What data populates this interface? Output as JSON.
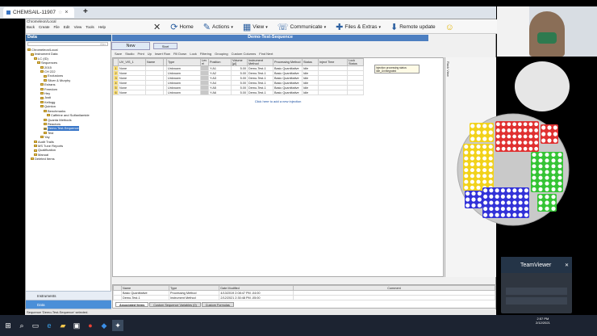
{
  "browser": {
    "tab_title": "CHEMSAIL-11907",
    "close_glyph": "×",
    "new_tab_glyph": "+"
  },
  "app": {
    "breadcrumb": "Chromeleon/Local",
    "toolbar": {
      "back": "Back",
      "create": "Create",
      "file": "File",
      "edit": "Edit",
      "view": "View",
      "tools": "Tools",
      "help": "Help"
    },
    "big_toolbar": {
      "home": "Home",
      "actions": "Actions",
      "view": "View",
      "communicate": "Communicate",
      "files_extras": "Files & Extras",
      "remote_update": "Remote update"
    },
    "left_panel": {
      "title": "Data",
      "filter_placeholder": "filter",
      "tree": [
        {
          "label": "Chromeleon/Local",
          "indent": 0
        },
        {
          "label": "Instrument Data",
          "indent": 1
        },
        {
          "label": "LC (ID)",
          "indent": 2
        },
        {
          "label": "Sequences",
          "indent": 3
        },
        {
          "label": "2015",
          "indent": 4
        },
        {
          "label": "CH 222",
          "indent": 4
        },
        {
          "label": "Exclusions",
          "indent": 5
        },
        {
          "label": "Silver & Murphy",
          "indent": 5
        },
        {
          "label": "Estrans",
          "indent": 4
        },
        {
          "label": "Freedom",
          "indent": 4
        },
        {
          "label": "Hey",
          "indent": 4
        },
        {
          "label": "Justi",
          "indent": 4
        },
        {
          "label": "Kellogg",
          "indent": 4
        },
        {
          "label": "Quinton",
          "indent": 4
        },
        {
          "label": "Benchmarks",
          "indent": 5
        },
        {
          "label": "Caffeine and Sulfanilamide",
          "indent": 6
        },
        {
          "label": "Quanta Methods",
          "indent": 5
        },
        {
          "label": "Reactors",
          "indent": 5
        },
        {
          "label": "Demo-Test-Sequence",
          "indent": 5,
          "selected": true
        },
        {
          "label": "Test",
          "indent": 5
        },
        {
          "label": "Yay",
          "indent": 4
        },
        {
          "label": "Audit Trails",
          "indent": 2
        },
        {
          "label": "MS Tune Reports",
          "indent": 2
        },
        {
          "label": "Qualification",
          "indent": 2
        },
        {
          "label": "Manual",
          "indent": 2
        },
        {
          "label": "Deleted Items",
          "indent": 1
        }
      ],
      "nav": [
        "Instruments",
        "Data",
        "eWorkflows"
      ]
    },
    "main": {
      "title": "Demo-Test-Sequence",
      "new_label": "New",
      "start_label": "Start",
      "toolbar": [
        "Save",
        "Studio",
        "Print",
        "Up",
        "Insert Row",
        "Fill Down",
        "Lock",
        "Filtering",
        "Grouping",
        "Custom Columns",
        "Find Next"
      ],
      "columns": [
        "",
        "UV_VIS_1",
        "Name",
        "",
        "Type",
        "Lev el",
        "Position",
        "Volume [µl]",
        "Instrument Method",
        "Processing Method",
        "Status",
        "Inject Time",
        "Lock Status"
      ],
      "rows": [
        {
          "num": "1",
          "uv": "None",
          "name": "",
          "type": "Unknown",
          "pos": "Y:A1",
          "vol": "5.00",
          "inst": "Demo-Test-1",
          "proc": "Basic Quantitative",
          "status": "Idle"
        },
        {
          "num": "2",
          "uv": "None",
          "name": "",
          "type": "Unknown",
          "pos": "Y:A2",
          "vol": "5.00",
          "inst": "Demo-Test-1",
          "proc": "Basic Quantitative",
          "status": "Idle"
        },
        {
          "num": "3",
          "uv": "None",
          "name": "",
          "type": "Unknown",
          "pos": "Y:A3",
          "vol": "5.00",
          "inst": "Demo-Test-1",
          "proc": "Basic Quantitative",
          "status": "Idle"
        },
        {
          "num": "4",
          "uv": "None",
          "name": "",
          "type": "Unknown",
          "pos": "Y:A4",
          "vol": "5.00",
          "inst": "Demo-Test-1",
          "proc": "Basic Quantitative",
          "status": "Idle"
        },
        {
          "num": "5",
          "uv": "None",
          "name": "",
          "type": "Unknown",
          "pos": "Y:A5",
          "vol": "5.00",
          "inst": "Demo-Test-1",
          "proc": "Basic Quantitative",
          "status": "Idle"
        },
        {
          "num": "6",
          "uv": "None",
          "name": "",
          "type": "Unknown",
          "pos": "Y:A6",
          "vol": "5.00",
          "inst": "Demo-Test-1",
          "proc": "Basic Quantitative",
          "status": "Idle"
        }
      ],
      "add_row": "Click here to add a new injection",
      "tooltip": "Injection processing status: Idle_Unintegrated"
    },
    "rack_label": "Rack View",
    "bottom": {
      "columns": [
        "Name",
        "Type",
        "Date Modified",
        "Comment"
      ],
      "rows": [
        {
          "name": "Basic Quantitative",
          "type": "Processing Method",
          "date": "4/13/2019 2:08:47 PM -04:00"
        },
        {
          "name": "Demo-Test-1",
          "type": "Instrument Method",
          "date": "2/12/2021 2:30:48 PM -05:00"
        }
      ],
      "tabs": [
        "Associated Items",
        "Custom Sequence Variables (0)",
        "Custom Formulas"
      ]
    },
    "status": "Sequence 'Demo-Test-Sequence' selected."
  },
  "teamviewer": {
    "title": "TeamViewer"
  },
  "clock": {
    "time": "2:57 PM",
    "date": "2/12/2021"
  },
  "colors": {
    "accent": "#4d7fc1",
    "sel_row": "#ffe27a"
  }
}
